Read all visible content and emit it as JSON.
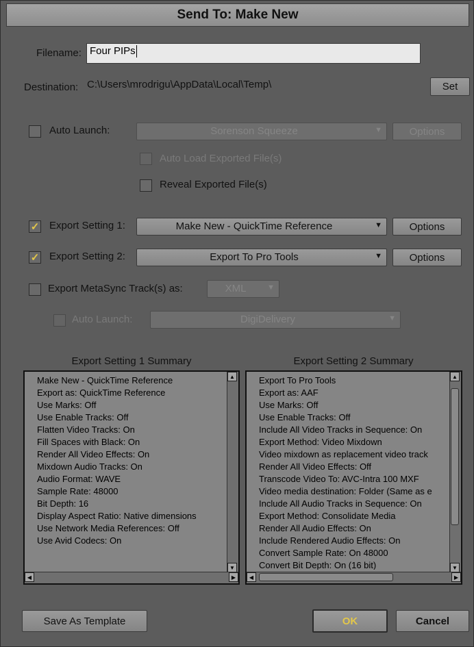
{
  "dialog": {
    "title": "Send To: Make New"
  },
  "filename": {
    "label": "Filename:",
    "value": "Four PIPs"
  },
  "destination": {
    "label": "Destination:",
    "path": "C:\\Users\\mrodrigu\\AppData\\Local\\Temp\\",
    "set_label": "Set"
  },
  "auto_launch": {
    "label": "Auto Launch:",
    "checked": false,
    "select_value": "Sorenson Squeeze",
    "options_label": "Options"
  },
  "auto_load": {
    "label": "Auto Load Exported File(s)",
    "checked": false
  },
  "reveal": {
    "label": "Reveal Exported File(s)",
    "checked": false
  },
  "export1": {
    "label": "Export Setting 1:",
    "checked": true,
    "select_value": "Make New - QuickTime Reference",
    "options_label": "Options"
  },
  "export2": {
    "label": "Export Setting 2:",
    "checked": true,
    "select_value": "Export To Pro Tools",
    "options_label": "Options"
  },
  "metasync": {
    "label": "Export MetaSync Track(s) as:",
    "checked": false,
    "select_value": "XML"
  },
  "meta_auto_launch": {
    "label": "Auto Launch:",
    "checked": false,
    "select_value": "DigiDelivery"
  },
  "summary1": {
    "title": "Export Setting 1 Summary",
    "lines": [
      "Make New - QuickTime Reference",
      "Export as: QuickTime Reference",
      "Use Marks: Off",
      "Use Enable Tracks: Off",
      "Flatten Video Tracks: On",
      "Fill Spaces with Black: On",
      "Render All Video Effects: On",
      "Mixdown Audio Tracks: On",
      "Audio Format: WAVE",
      "Sample Rate: 48000",
      "Bit Depth: 16",
      "Display Aspect Ratio: Native dimensions",
      "Use Network Media References: Off",
      "Use Avid Codecs: On"
    ]
  },
  "summary2": {
    "title": "Export Setting 2 Summary",
    "lines": [
      "Export To Pro Tools",
      "Export as: AAF",
      "Use Marks: Off",
      "Use Enable Tracks: Off",
      "Include All Video Tracks in Sequence: On",
      "Export Method: Video Mixdown",
      "Video mixdown as replacement video track",
      "Render All Video Effects: Off",
      "Transcode Video To: AVC-Intra 100  MXF",
      "Video media destination: Folder (Same as e",
      "Include All Audio Tracks in Sequence: On",
      "Export Method: Consolidate Media",
      "Render All Audio Effects: On",
      "Include Rendered Audio Effects: On",
      "Convert Sample Rate: On  48000",
      "Convert Bit Depth: On  (16 bit)"
    ]
  },
  "footer": {
    "save_template_label": "Save As Template",
    "ok_label": "OK",
    "cancel_label": "Cancel"
  },
  "colors": {
    "background": "#5c5c5c",
    "check": "#e3c74a",
    "ok_text": "#e3c74a"
  },
  "icons": {
    "checkmark": "checkmark-icon",
    "dropdown": "chevron-down-icon",
    "scroll_up": "arrow-up-icon",
    "scroll_down": "arrow-down-icon",
    "scroll_left": "arrow-left-icon",
    "scroll_right": "arrow-right-icon"
  }
}
